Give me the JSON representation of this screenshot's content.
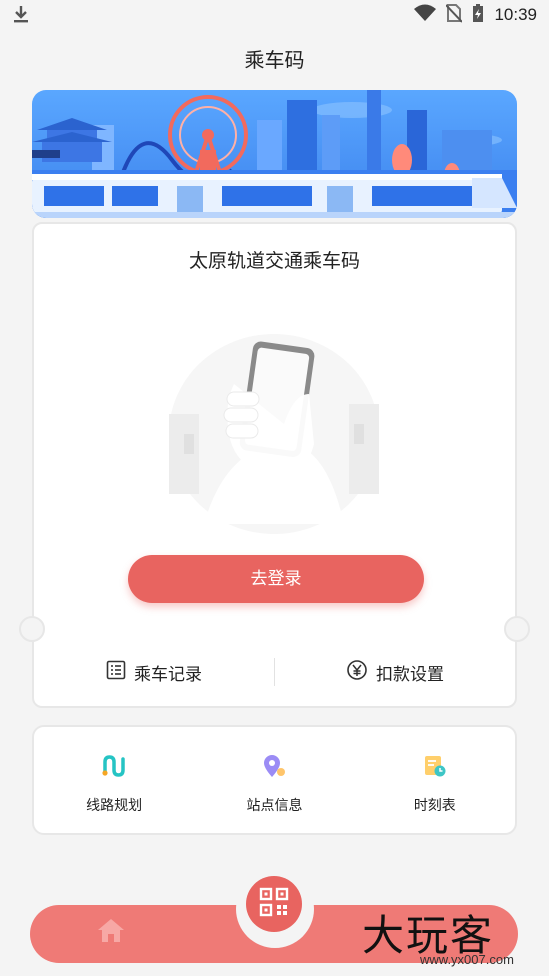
{
  "status_bar": {
    "time": "10:39",
    "icons": [
      "download-icon",
      "wifi-icon",
      "no-sim-icon",
      "battery-charging-icon"
    ]
  },
  "header": {
    "title": "乘车码"
  },
  "banner": {
    "icon": "city-train-illustration"
  },
  "card": {
    "title": "太原轨道交通乘车码",
    "login_label": "去登录",
    "actions": [
      {
        "label": "乘车记录",
        "icon": "list-icon"
      },
      {
        "label": "扣款设置",
        "icon": "yuan-cycle-icon"
      }
    ]
  },
  "services": [
    {
      "label": "线路规划",
      "icon": "route-icon"
    },
    {
      "label": "站点信息",
      "icon": "location-pin-icon"
    },
    {
      "label": "时刻表",
      "icon": "timetable-icon"
    }
  ],
  "tab_bar": {
    "home_icon": "home-icon",
    "center_icon": "qr-code-icon"
  },
  "watermark": {
    "text": "大玩客",
    "sub": "www.yx007.com"
  },
  "colors": {
    "primary": "#e86460",
    "tab_bar": "#ef7a76",
    "background": "#f4f4f4"
  }
}
